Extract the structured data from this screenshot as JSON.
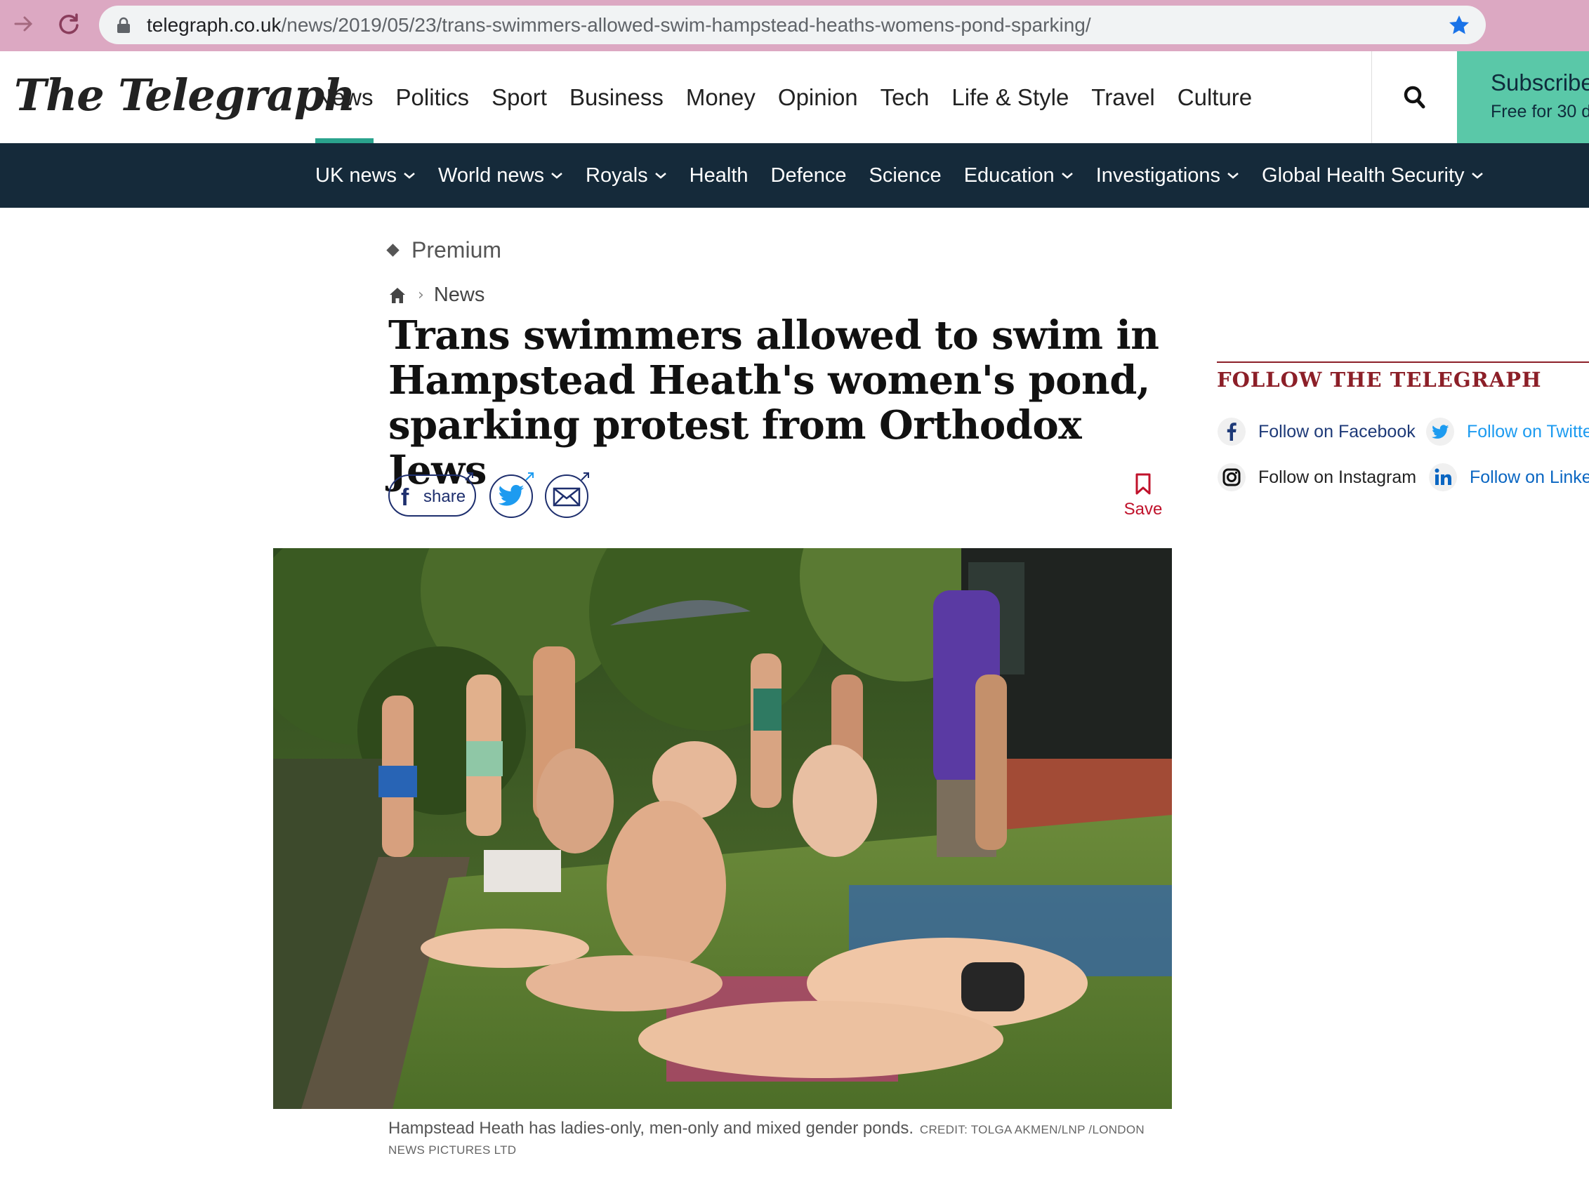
{
  "browser": {
    "url_host": "telegraph.co.uk",
    "url_path": "/news/2019/05/23/trans-swimmers-allowed-swim-hampstead-heaths-womens-pond-sparking/"
  },
  "site": {
    "logo": "The Telegraph",
    "main_nav": [
      {
        "label": "News",
        "active": true
      },
      {
        "label": "Politics"
      },
      {
        "label": "Sport"
      },
      {
        "label": "Business"
      },
      {
        "label": "Money"
      },
      {
        "label": "Opinion"
      },
      {
        "label": "Tech"
      },
      {
        "label": "Life & Style"
      },
      {
        "label": "Travel"
      },
      {
        "label": "Culture"
      }
    ],
    "subscribe_title": "Subscribe",
    "subscribe_sub": "Free for 30 d",
    "sub_nav": [
      {
        "label": "UK news",
        "dropdown": true
      },
      {
        "label": "World news",
        "dropdown": true
      },
      {
        "label": "Royals",
        "dropdown": true
      },
      {
        "label": "Health",
        "dropdown": false
      },
      {
        "label": "Defence",
        "dropdown": false
      },
      {
        "label": "Science",
        "dropdown": false
      },
      {
        "label": "Education",
        "dropdown": true
      },
      {
        "label": "Investigations",
        "dropdown": true
      },
      {
        "label": "Global Health Security",
        "dropdown": true
      }
    ]
  },
  "article": {
    "premium_label": "Premium",
    "breadcrumb": "News",
    "headline": "Trans swimmers allowed to swim in Hampstead Heath's women's pond, sparking protest from Orthodox Jews",
    "share_label": "share",
    "save_label": "Save",
    "caption": "Hampstead Heath has ladies-only, men-only and mixed gender ponds.",
    "credit": "CREDIT: TOLGA AKMEN/LNP /LONDON NEWS PICTURES LTD"
  },
  "sidebar": {
    "title": "FOLLOW THE TELEGRAPH",
    "links": [
      {
        "label": "Follow on Facebook",
        "icon": "facebook-icon",
        "color": "#1e3a78"
      },
      {
        "label": "Follow on Twitte",
        "icon": "twitter-icon",
        "color": "#1d9bf0"
      },
      {
        "label": "Follow on Instagram",
        "icon": "instagram-icon",
        "color": "#222222"
      },
      {
        "label": "Follow on Linke",
        "icon": "linkedin-icon",
        "color": "#0a66c2"
      }
    ]
  },
  "colors": {
    "browser_bar": "#dca8c2",
    "subnav_bg": "#152a3a",
    "subscribe_bg": "#5ac8a8",
    "nav_active": "#2aa38d",
    "follow_red": "#8c1f28",
    "save_red": "#c0122b"
  }
}
